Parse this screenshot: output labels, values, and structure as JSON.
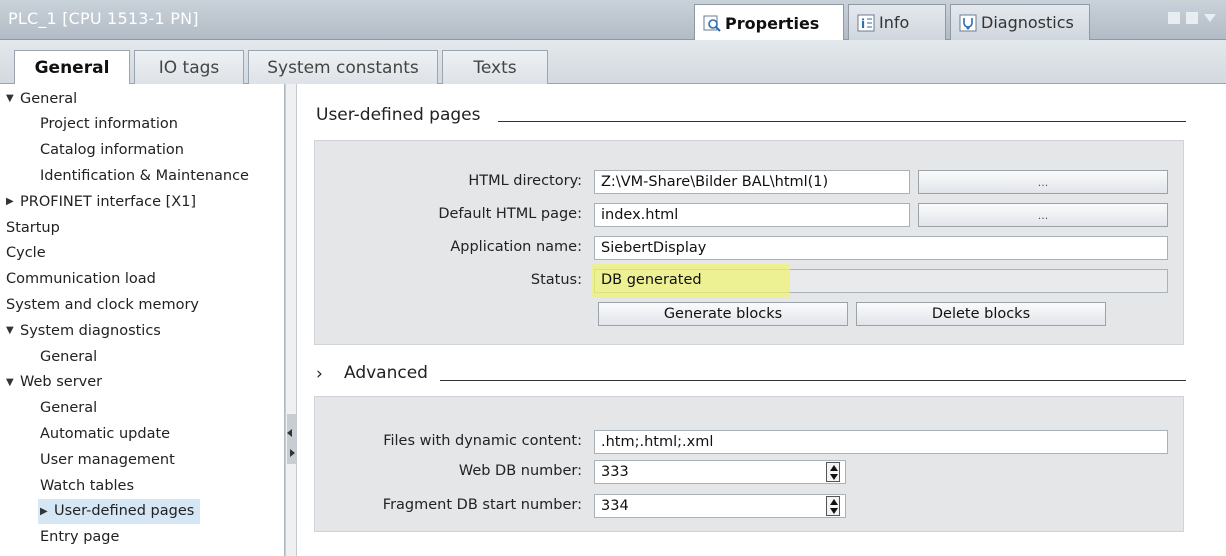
{
  "titlebar": {
    "title": "PLC_1 [CPU 1513-1 PN]",
    "tabs": [
      {
        "label": "Properties",
        "icon": "properties-icon"
      },
      {
        "label": "Info",
        "icon": "info-icon"
      },
      {
        "label": "Diagnostics",
        "icon": "diagnostics-icon"
      }
    ]
  },
  "tabs": [
    {
      "label": "General"
    },
    {
      "label": "IO tags"
    },
    {
      "label": "System constants"
    },
    {
      "label": "Texts"
    }
  ],
  "tree": [
    {
      "label": "General",
      "expander": "▼"
    },
    {
      "label": "Project information"
    },
    {
      "label": "Catalog information"
    },
    {
      "label": "Identification & Maintenance"
    },
    {
      "label": "PROFINET interface [X1]",
      "expander": "▶"
    },
    {
      "label": "Startup"
    },
    {
      "label": "Cycle"
    },
    {
      "label": "Communication load"
    },
    {
      "label": "System and clock memory"
    },
    {
      "label": "System diagnostics",
      "expander": "▼"
    },
    {
      "label": "General"
    },
    {
      "label": "Web server",
      "expander": "▼"
    },
    {
      "label": "General"
    },
    {
      "label": "Automatic update"
    },
    {
      "label": "User management"
    },
    {
      "label": "Watch tables"
    },
    {
      "label": "User-defined pages",
      "expander": "▶"
    },
    {
      "label": "Entry page"
    }
  ],
  "user_pages": {
    "title": "User-defined pages",
    "html_dir_label": "HTML directory:",
    "html_dir_value": "Z:\\VM-Share\\Bilder BAL\\html(1)",
    "default_page_label": "Default HTML page:",
    "default_page_value": "index.html",
    "app_name_label": "Application name:",
    "app_name_value": "SiebertDisplay",
    "status_label": "Status:",
    "status_value": "DB generated",
    "browse_label": "...",
    "generate_label": "Generate blocks",
    "delete_label": "Delete blocks"
  },
  "advanced": {
    "expander": "›",
    "title": "Advanced",
    "files_label": "Files with dynamic content:",
    "files_value": ".htm;.html;.xml",
    "webdb_label": "Web DB number:",
    "webdb_value": "333",
    "fragdb_label": "Fragment DB start number:",
    "fragdb_value": "334"
  },
  "colors": {
    "highlight": "#f0f46e",
    "selected_item": "#d5e6f4"
  }
}
